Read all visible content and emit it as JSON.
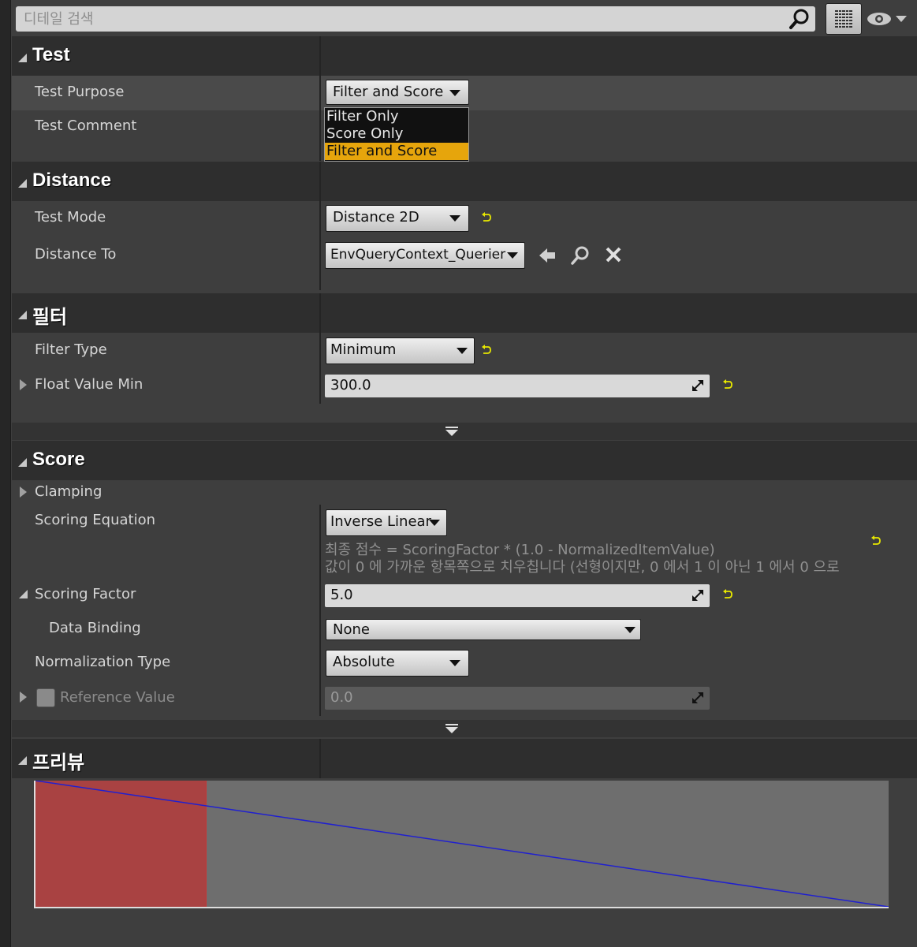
{
  "search": {
    "placeholder": "디테일 검색"
  },
  "toolbar": {
    "grid_icon": "view-options-grid-icon",
    "eye_icon": "visibility-eye-icon"
  },
  "sections": {
    "test": {
      "title": "Test",
      "test_purpose_label": "Test Purpose",
      "test_purpose_value": "Filter and Score",
      "test_purpose_options": [
        "Filter Only",
        "Score Only",
        "Filter and Score"
      ],
      "test_comment_label": "Test Comment"
    },
    "distance": {
      "title": "Distance",
      "test_mode_label": "Test Mode",
      "test_mode_value": "Distance 2D",
      "distance_to_label": "Distance To",
      "distance_to_value": "EnvQueryContext_Querier"
    },
    "filter": {
      "title": "필터",
      "filter_type_label": "Filter Type",
      "filter_type_value": "Minimum",
      "float_value_min_label": "Float Value Min",
      "float_value_min_value": "300.0"
    },
    "score": {
      "title": "Score",
      "clamping_label": "Clamping",
      "scoring_equation_label": "Scoring Equation",
      "scoring_equation_value": "Inverse Linear",
      "equation_desc_1": "최종 점수 = ScoringFactor * (1.0 - NormalizedItemValue)",
      "equation_desc_2": "값이 0 에 가까운 항목쪽으로 치우칩니다 (선형이지만, 0 에서 1 이 아닌 1 에서 0 으로",
      "scoring_factor_label": "Scoring Factor",
      "scoring_factor_value": "5.0",
      "data_binding_label": "Data Binding",
      "data_binding_value": "None",
      "normalization_type_label": "Normalization Type",
      "normalization_type_value": "Absolute",
      "reference_value_label": "Reference Value",
      "reference_value_value": "0.0"
    },
    "preview": {
      "title": "프리뷰",
      "filtered_fraction": 0.2,
      "line_start": 1.0,
      "line_end": 0.0
    }
  },
  "colors": {
    "highlight": "#e6a50c",
    "filtered_region": "#a94242",
    "curve": "#2020d0",
    "reset_arrow": "#e8e800"
  }
}
